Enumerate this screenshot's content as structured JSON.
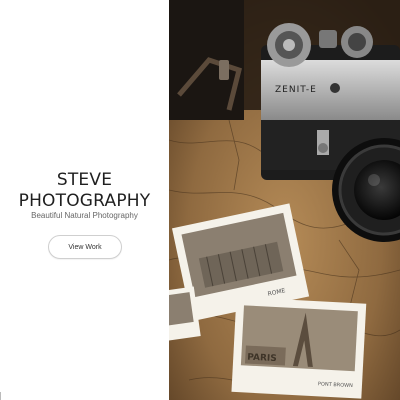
{
  "hero": {
    "title": "STEVE PHOTOGRAPHY",
    "tagline": "Beautiful Natural Photography",
    "button_label": "View Work"
  },
  "photo": {
    "subject": "vintage camera with polaroid photos on a map",
    "camera_brand": "ZENIT-E",
    "polaroid1_caption": "ROME",
    "polaroid2_caption": "PARIS",
    "polaroid2_small_caption": "PONT BROWN"
  },
  "colors": {
    "background": "#ffffff",
    "text_dark": "#1f1f1f",
    "text_muted": "#666666",
    "button_border": "#cfcfcf"
  }
}
